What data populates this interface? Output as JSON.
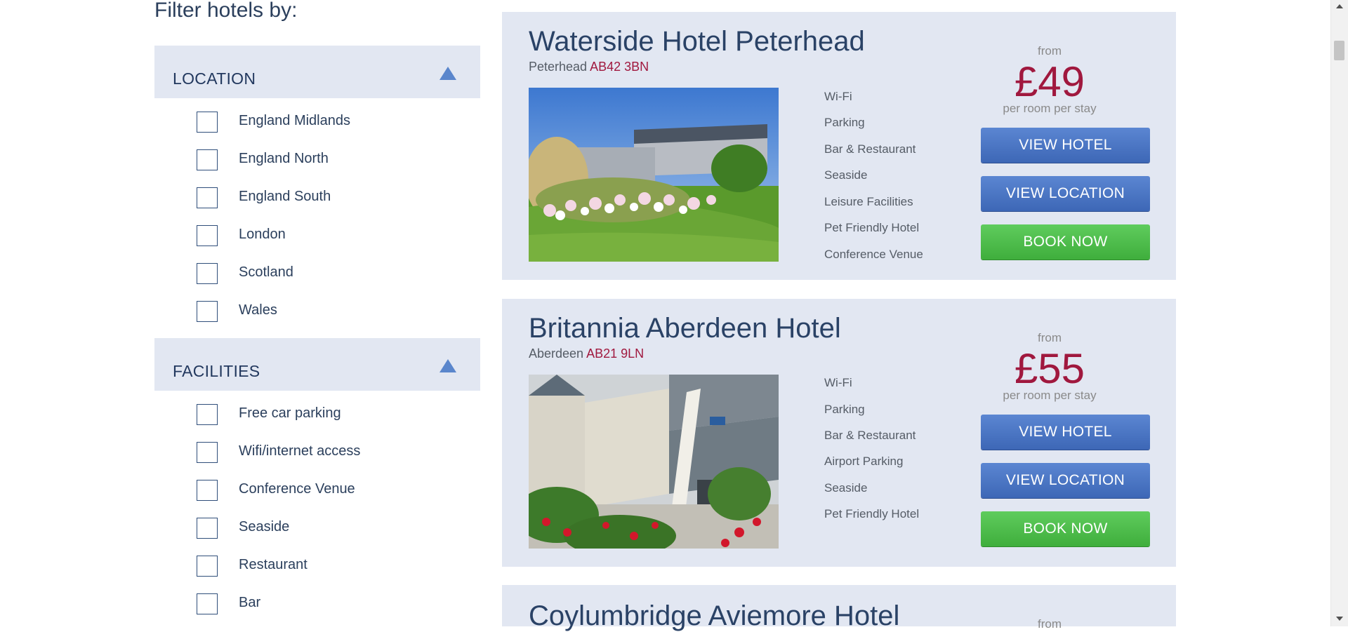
{
  "filters": {
    "title": "Filter hotels by:",
    "groups": [
      {
        "label": "LOCATION",
        "options": [
          "England Midlands",
          "England North",
          "England South",
          "London",
          "Scotland",
          "Wales"
        ]
      },
      {
        "label": "FACILITIES",
        "options": [
          "Free car parking",
          "Wifi/internet access",
          "Conference Venue",
          "Seaside",
          "Restaurant",
          "Bar"
        ]
      }
    ]
  },
  "hotels": [
    {
      "name": "Waterside Hotel Peterhead",
      "town": "Peterhead",
      "postcode": "AB42 3BN",
      "features": [
        "Wi-Fi",
        "Parking",
        "Bar & Restaurant",
        "Seaside",
        "Leisure Facilities",
        "Pet Friendly Hotel",
        "Conference Venue"
      ],
      "price_from": "from",
      "price": "£49",
      "price_unit": "per room per stay",
      "buttons": {
        "view_hotel": "VIEW HOTEL",
        "view_location": "VIEW LOCATION",
        "book_now": "BOOK NOW"
      }
    },
    {
      "name": "Britannia Aberdeen Hotel",
      "town": "Aberdeen",
      "postcode": "AB21 9LN",
      "features": [
        "Wi-Fi",
        "Parking",
        "Bar & Restaurant",
        "Airport Parking",
        "Seaside",
        "Pet Friendly Hotel"
      ],
      "price_from": "from",
      "price": "£55",
      "price_unit": "per room per stay",
      "buttons": {
        "view_hotel": "VIEW HOTEL",
        "view_location": "VIEW LOCATION",
        "book_now": "BOOK NOW"
      }
    },
    {
      "name": "Coylumbridge Aviemore Hotel",
      "price_from": "from"
    }
  ],
  "colors": {
    "accent_blue": "#4a76c4",
    "book_green": "#4cbb4a",
    "price_red": "#a0183e",
    "panel_bg": "#e2e7f2"
  }
}
